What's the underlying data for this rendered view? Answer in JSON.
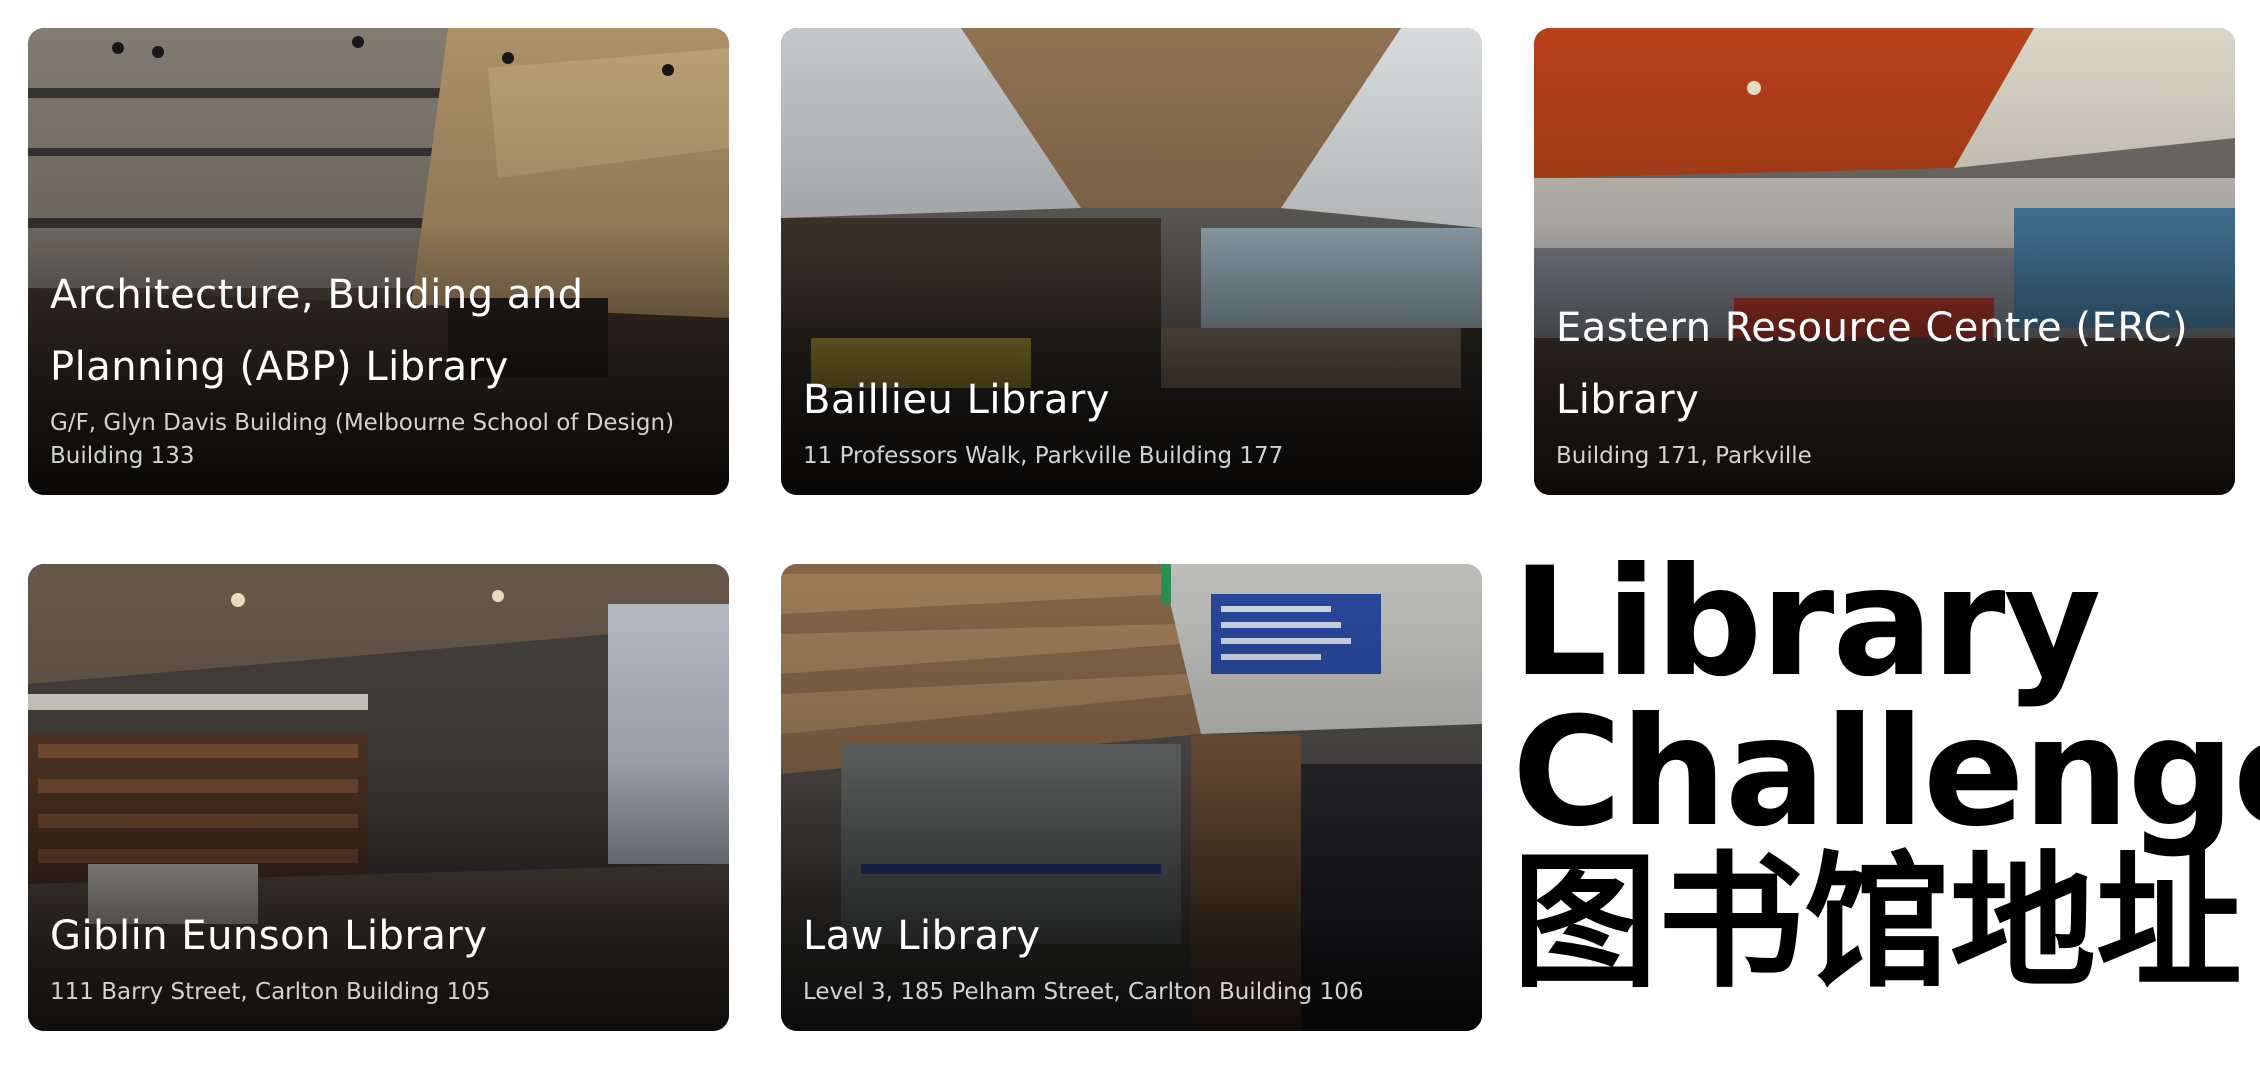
{
  "cards": [
    {
      "title": "Architecture, Building and Planning (ABP) Library",
      "address": "G/F, Glyn Davis Building (Melbourne School of Design) Building 133"
    },
    {
      "title": "Baillieu Library",
      "address": "11 Professors Walk, Parkville Building 177"
    },
    {
      "title": "Eastern Resource Centre (ERC) Library",
      "address": "Building 171, Parkville"
    },
    {
      "title": "Giblin Eunson Library",
      "address": "111 Barry Street, Carlton Building 105"
    },
    {
      "title": "Law Library",
      "address": "Level 3, 185 Pelham Street, Carlton Building 106"
    }
  ],
  "headline": {
    "line1": "Library",
    "line2": "Challenge",
    "line3": "图书馆地址"
  },
  "colors": {
    "card_text": "#ffffff",
    "address_text": "#d2d2d2",
    "headline_text": "#000000"
  }
}
